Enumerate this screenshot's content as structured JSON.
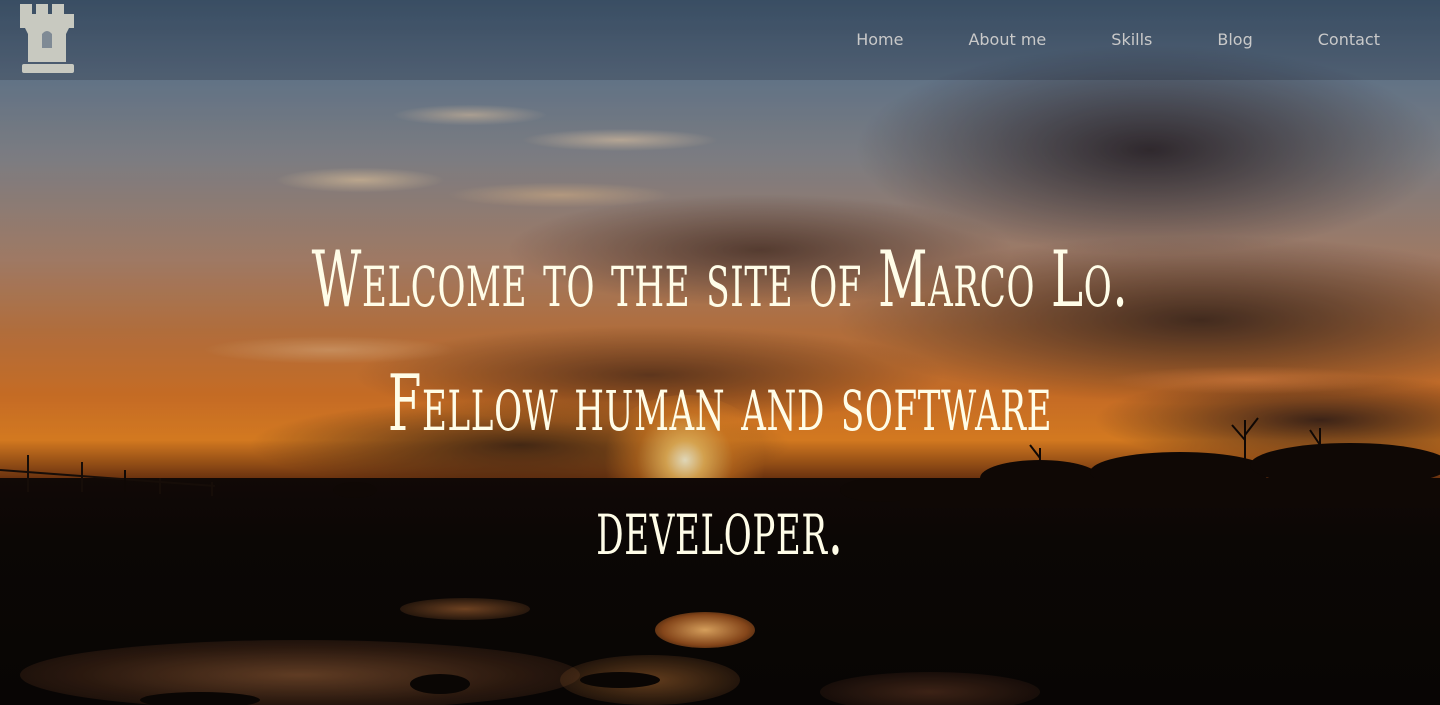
{
  "navbar": {
    "logo_icon": "castle-tower-icon",
    "links": [
      "Home",
      "About me",
      "Skills",
      "Blog",
      "Contact"
    ]
  },
  "hero": {
    "line1": "Welcome to the site of Marco Lo.",
    "line2": "Fellow human and software",
    "line3": "developer."
  },
  "colors": {
    "hero_text": "#fffde8",
    "nav_text": "#c9c9c9",
    "logo": "#c8c9c0"
  }
}
